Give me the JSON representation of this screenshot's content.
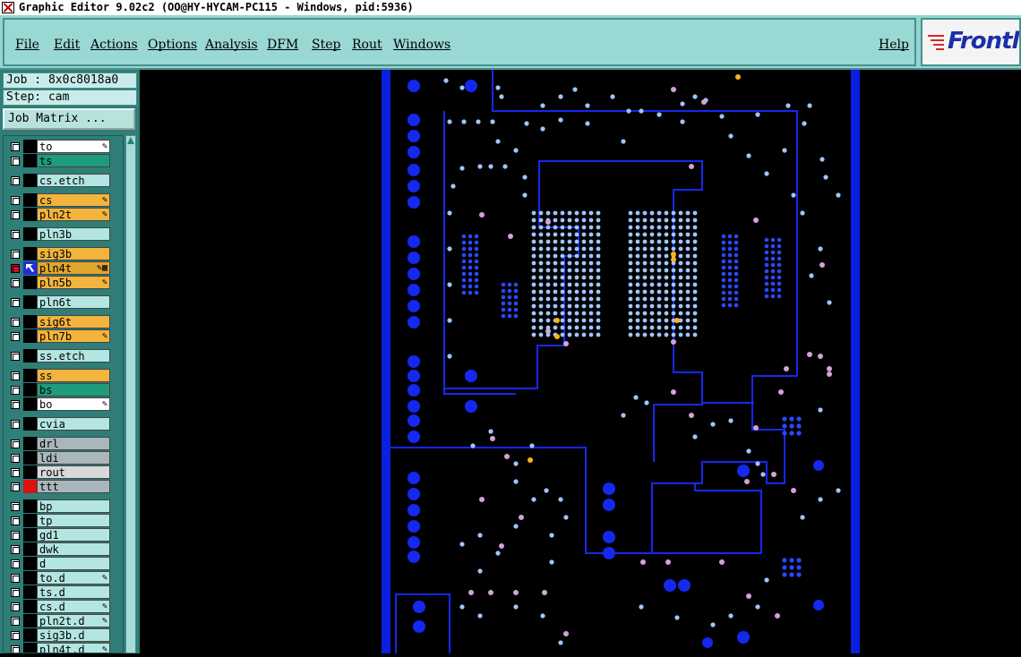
{
  "window": {
    "title": "Graphic Editor 9.02c2 (OO@HY-HYCAM-PC115 - Windows, pid:5936)"
  },
  "menu": {
    "file": "File",
    "edit": "Edit",
    "actions": "Actions",
    "options": "Options",
    "analysis": "Analysis",
    "dfm": "DFM",
    "step": "Step",
    "rout": "Rout",
    "windows": "Windows",
    "help": "Help"
  },
  "logo": {
    "text": "Frontl"
  },
  "job": {
    "label": "Job : 8x0c8018a0",
    "step": "Step: cam",
    "matrix_button": "Job Matrix ..."
  },
  "colors": {
    "panel": "#2f7e78",
    "menu": "#93d5d1",
    "board_outline": "#0a1fe0",
    "pad": "#9fc6ff",
    "orange_layer": "#f2b43c",
    "green_layer": "#1f9c7d"
  },
  "layers": [
    {
      "name": "to",
      "bg": "#ffffff",
      "icon": "pen"
    },
    {
      "name": "ts",
      "bg": "#1f9c7d",
      "icon": ""
    },
    {
      "name": "cs.etch",
      "bg": "#b3e6e2",
      "icon": ""
    },
    {
      "name": "cs",
      "bg": "#f2b43c",
      "icon": "pen"
    },
    {
      "name": "pln2t",
      "bg": "#f2b43c",
      "icon": "pen"
    },
    {
      "name": "pln3b",
      "bg": "#b3e6e2",
      "icon": ""
    },
    {
      "name": "sig3b",
      "bg": "#f2b43c",
      "icon": ""
    },
    {
      "name": "pln4t",
      "bg": "#e0a62c",
      "icon": "pen-grid",
      "work": true
    },
    {
      "name": "pln5b",
      "bg": "#f2b43c",
      "icon": "pen"
    },
    {
      "name": "pln6t",
      "bg": "#b3e6e2",
      "icon": ""
    },
    {
      "name": "sig6t",
      "bg": "#f2b43c",
      "icon": ""
    },
    {
      "name": "pln7b",
      "bg": "#f2b43c",
      "icon": "pen"
    },
    {
      "name": "ss.etch",
      "bg": "#b3e6e2",
      "icon": ""
    },
    {
      "name": "ss",
      "bg": "#f2b43c",
      "icon": ""
    },
    {
      "name": "bs",
      "bg": "#1f9c7d",
      "icon": ""
    },
    {
      "name": "bo",
      "bg": "#ffffff",
      "icon": "pen"
    },
    {
      "name": "cvia",
      "bg": "#b3e6e2",
      "icon": ""
    },
    {
      "name": "drl",
      "bg": "#a9b7bd",
      "icon": ""
    },
    {
      "name": "ldi",
      "bg": "#a9b7bd",
      "icon": ""
    },
    {
      "name": "rout",
      "bg": "#d9d9d9",
      "icon": ""
    },
    {
      "name": "ttt",
      "bg": "#a9b7bd",
      "icon": "",
      "redcolor": true
    },
    {
      "name": "bp",
      "bg": "#b3e6e2",
      "icon": ""
    },
    {
      "name": "tp",
      "bg": "#b3e6e2",
      "icon": ""
    },
    {
      "name": "gd1",
      "bg": "#b3e6e2",
      "icon": ""
    },
    {
      "name": "dwk",
      "bg": "#b3e6e2",
      "icon": ""
    },
    {
      "name": "d",
      "bg": "#b3e6e2",
      "icon": ""
    },
    {
      "name": "to.d",
      "bg": "#b3e6e2",
      "icon": "pen"
    },
    {
      "name": "ts.d",
      "bg": "#b3e6e2",
      "icon": ""
    },
    {
      "name": "cs.d",
      "bg": "#b3e6e2",
      "icon": "pen"
    },
    {
      "name": "pln2t.d",
      "bg": "#b3e6e2",
      "icon": "pen"
    },
    {
      "name": "sig3b.d",
      "bg": "#b3e6e2",
      "icon": ""
    },
    {
      "name": "pln4t.d",
      "bg": "#b3e6e2",
      "icon": "pen"
    }
  ]
}
